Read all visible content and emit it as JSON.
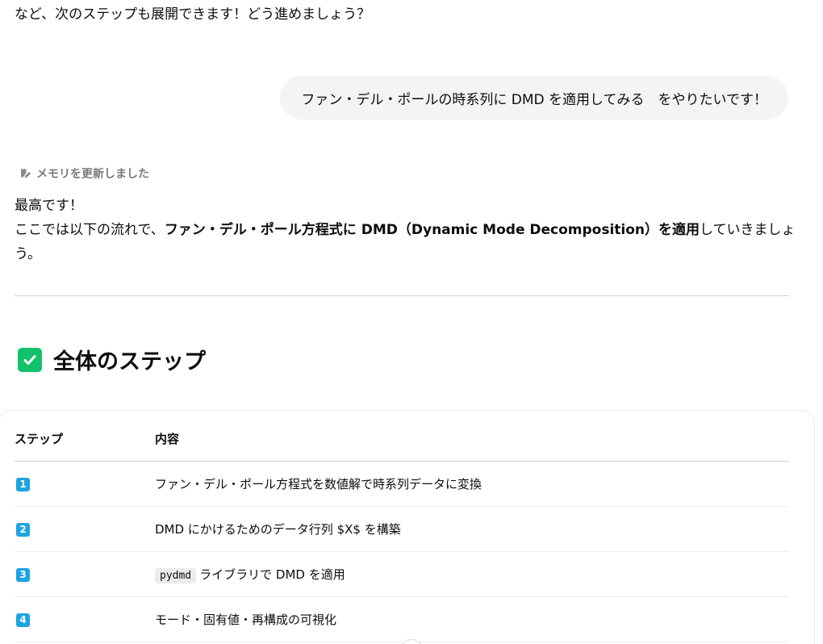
{
  "previous_message": {
    "tail_text": "など、次のステップも展開できます！どう進めましょう？"
  },
  "user_message": {
    "text": "ファン・デル・ポールの時系列に DMD を適用してみる　をやりたいです！"
  },
  "memory_note": {
    "icon": "memory-edit-icon",
    "text": "メモリを更新しました"
  },
  "answer": {
    "greeting": "最高です！",
    "intro_before": "ここでは以下の流れで、",
    "intro_bold1": "ファン・デル・ポール方程式に DMD（Dynamic Mode Decomposition）を適用",
    "intro_after": "していきましょう。"
  },
  "section": {
    "icon": "check-mark-button-icon",
    "title": "全体のステップ"
  },
  "steps_table": {
    "headers": [
      "ステップ",
      "内容"
    ],
    "rows": [
      {
        "step": "1",
        "code": "",
        "content": "ファン・デル・ポール方程式を数値解で時系列データに変換"
      },
      {
        "step": "2",
        "code": "",
        "content": "DMD にかけるためのデータ行列 $X$ を構築"
      },
      {
        "step": "3",
        "code": "pydmd",
        "content": "ライブラリで DMD を適用"
      },
      {
        "step": "4",
        "code": "",
        "content": "モード・固有値・再構成の可視化"
      }
    ]
  },
  "colors": {
    "user_bubble_bg": "#f4f4f4",
    "check_green": "#12c26b",
    "step_badge_blue": "#1fa3e0",
    "muted_text": "#7a7a7a"
  }
}
